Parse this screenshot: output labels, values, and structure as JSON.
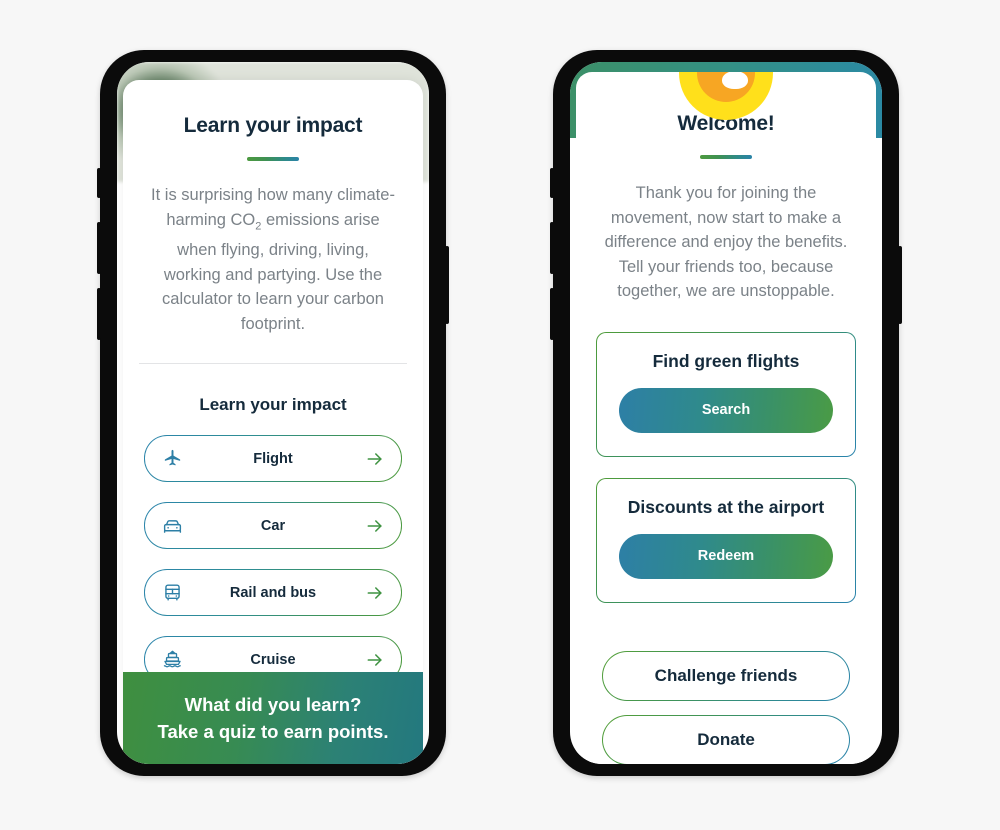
{
  "theme": {
    "page_background": "#f7f7f7",
    "heading_color": "#152b3c",
    "body_text_color": "#7b8288",
    "accent_green": "#4e9b3c",
    "accent_teal": "#2f8b86",
    "accent_blue": "#2a83ad",
    "sun_yellow": "#ffe01b",
    "sun_orange": "#f7a623"
  },
  "left_phone": {
    "name": "learn-your-impact-screen",
    "sheet_title": "Learn your impact",
    "body_text_before": "It is surprising how many climate-harming CO",
    "body_subscript": "2",
    "body_text_after": " emissions arise when flying, driving, living, working and partying. Use the calculator to learn your carbon footprint.",
    "section_title": "Learn your impact",
    "options": [
      {
        "label": "Flight",
        "icon": "airplane-icon",
        "arrow_icon": "arrow-right-icon"
      },
      {
        "label": "Car",
        "icon": "car-icon",
        "arrow_icon": "arrow-right-icon"
      },
      {
        "label": "Rail and bus",
        "icon": "bus-icon",
        "arrow_icon": "arrow-right-icon"
      },
      {
        "label": "Cruise",
        "icon": "ship-icon",
        "arrow_icon": "arrow-right-icon"
      }
    ],
    "banner": {
      "line1": "What did you learn?",
      "line2": "Take a quiz to earn points."
    }
  },
  "right_phone": {
    "name": "welcome-screen",
    "hero_icon": "sun-icon",
    "title": "Welcome!",
    "body": "Thank you for joining the movement, now start to make a difference and enjoy the benefits. Tell your friends too, because together, we are unstoppable.",
    "promos": [
      {
        "title": "Find green flights",
        "button_label": "Search"
      },
      {
        "title": "Discounts at the airport",
        "button_label": "Redeem"
      }
    ],
    "secondary_actions": [
      {
        "label": "Challenge friends"
      },
      {
        "label": "Donate"
      }
    ]
  }
}
